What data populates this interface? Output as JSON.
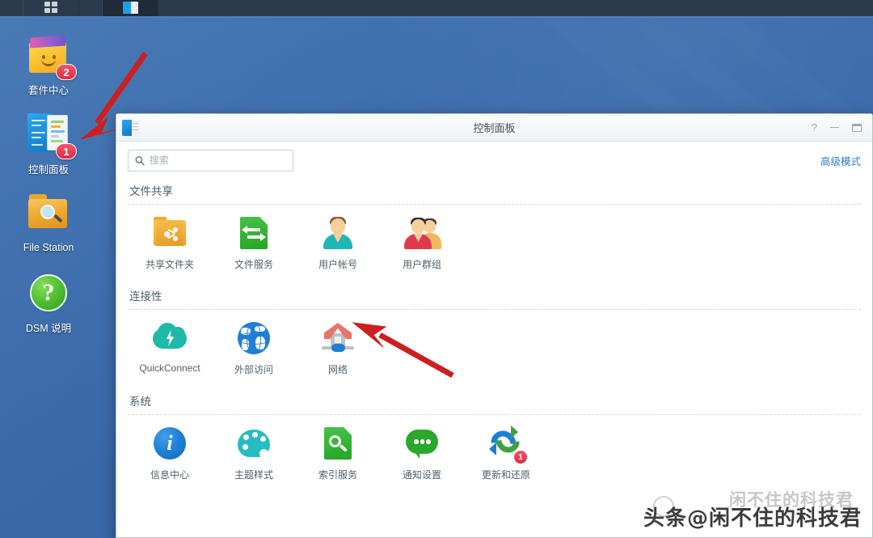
{
  "desktop": {
    "background_color": "#3b6ead",
    "icons": [
      {
        "label": "套件中心",
        "icon": "package-center-icon",
        "badge": "2"
      },
      {
        "label": "控制面板",
        "icon": "control-panel-icon",
        "badge": "1"
      },
      {
        "label": "File Station",
        "icon": "file-station-folder-icon",
        "badge": ""
      },
      {
        "label": "DSM 说明",
        "icon": "help-question-icon",
        "badge": ""
      }
    ]
  },
  "taskbar": {
    "items": [
      {
        "name": "apps-grid-icon"
      },
      {
        "name": "control-panel-taskbar-icon"
      }
    ]
  },
  "window": {
    "title": "控制面板",
    "icon": "control-panel-icon",
    "controls": {
      "help": "?",
      "minimize": "—",
      "maximize": "❐"
    },
    "toolbar": {
      "search_placeholder": "搜索",
      "search_value": "",
      "search_icon": "search-icon",
      "advanced_mode": "高级模式",
      "advanced_mode_color": "#2c7fd0"
    },
    "sections": [
      {
        "title": "文件共享",
        "tiles": [
          {
            "label": "共享文件夹",
            "icon": "shared-folder-icon",
            "badge": ""
          },
          {
            "label": "文件服务",
            "icon": "file-services-icon",
            "badge": ""
          },
          {
            "label": "用户帐号",
            "icon": "user-account-icon",
            "badge": ""
          },
          {
            "label": "用户群组",
            "icon": "user-group-icon",
            "badge": ""
          }
        ]
      },
      {
        "title": "连接性",
        "tiles": [
          {
            "label": "QuickConnect",
            "icon": "quickconnect-cloud-icon",
            "badge": ""
          },
          {
            "label": "外部访问",
            "icon": "external-access-globe-icon",
            "badge": ""
          },
          {
            "label": "网络",
            "icon": "network-house-icon",
            "badge": ""
          }
        ]
      },
      {
        "title": "系统",
        "tiles": [
          {
            "label": "信息中心",
            "icon": "info-center-icon",
            "badge": ""
          },
          {
            "label": "主题样式",
            "icon": "theme-palette-icon",
            "badge": ""
          },
          {
            "label": "索引服务",
            "icon": "indexing-service-icon",
            "badge": ""
          },
          {
            "label": "通知设置",
            "icon": "notification-bubble-icon",
            "badge": ""
          },
          {
            "label": "更新和还原",
            "icon": "update-restore-icon",
            "badge": "1"
          }
        ]
      }
    ]
  },
  "annotations": {
    "arrow_color": "#cc1f1f",
    "arrows": [
      {
        "name": "arrow-to-control-panel-desktop-icon",
        "points_to": "控制面板"
      },
      {
        "name": "arrow-to-network-tile",
        "points_to": "网络"
      }
    ]
  },
  "watermark": {
    "main": "头条@闲不住的科技君",
    "faint": "闲不住的科技君"
  }
}
